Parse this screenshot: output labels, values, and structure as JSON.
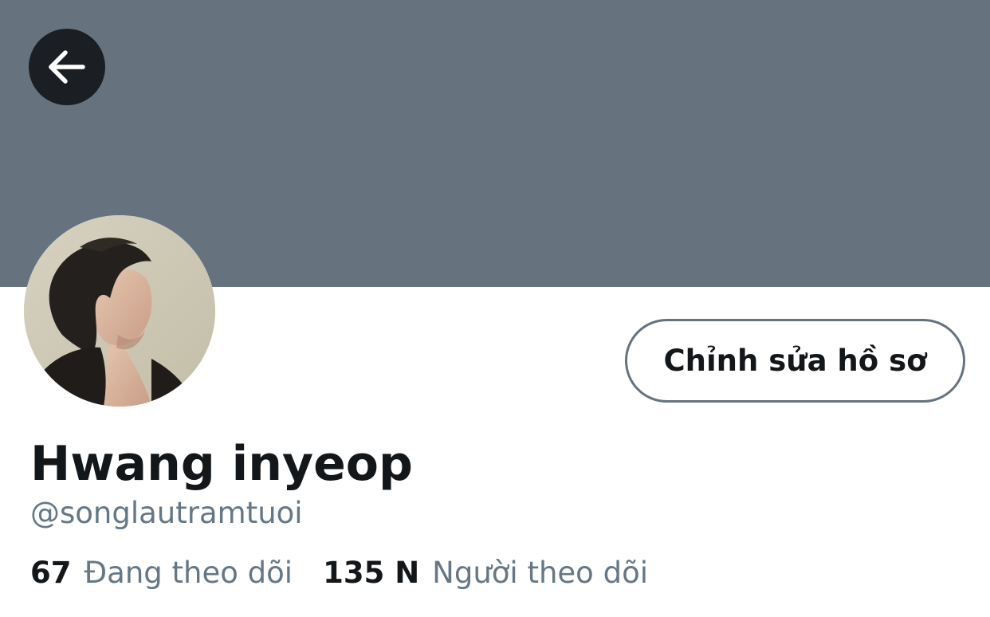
{
  "header": {
    "back_icon": "arrow-left-icon"
  },
  "colors": {
    "banner": "#66737f",
    "back_button_bg": "#1b1f23",
    "text_primary": "#14171a",
    "text_secondary": "#657786",
    "button_border": "#66737f"
  },
  "profile": {
    "display_name": "Hwang inyeop",
    "handle": "@songlautramtuoi",
    "edit_button_label": "Chỉnh sửa hồ sơ"
  },
  "stats": {
    "following_count": "67",
    "following_label": "Đang theo dõi",
    "followers_count": "135 N",
    "followers_label": "Người theo dõi"
  }
}
